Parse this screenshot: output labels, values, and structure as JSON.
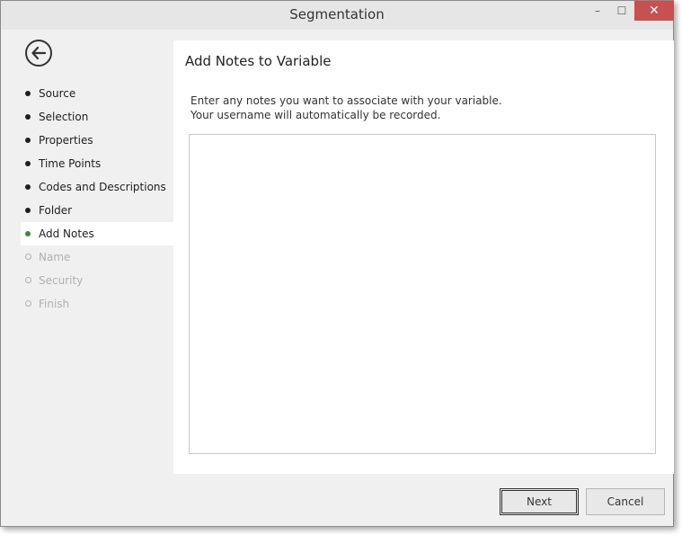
{
  "window": {
    "title": "Segmentation",
    "minimize_glyph": "–",
    "maximize_glyph": "☐",
    "close_glyph": "✕"
  },
  "nav": {
    "items": [
      {
        "label": "Source",
        "state": "done"
      },
      {
        "label": "Selection",
        "state": "done"
      },
      {
        "label": "Properties",
        "state": "done"
      },
      {
        "label": "Time Points",
        "state": "done"
      },
      {
        "label": "Codes and Descriptions",
        "state": "done"
      },
      {
        "label": "Folder",
        "state": "done"
      },
      {
        "label": "Add Notes",
        "state": "active"
      },
      {
        "label": "Name",
        "state": "pending"
      },
      {
        "label": "Security",
        "state": "pending"
      },
      {
        "label": "Finish",
        "state": "pending"
      }
    ]
  },
  "panel": {
    "title": "Add Notes to Variable",
    "instruction_line1": "Enter any notes you want to associate with your variable.",
    "instruction_line2": "Your username will automatically be recorded.",
    "notes_value": ""
  },
  "buttons": {
    "next_label": "Next",
    "cancel_label": "Cancel"
  },
  "colors": {
    "active_bullet": "#3c8a3c",
    "close_button": "#c75050"
  }
}
